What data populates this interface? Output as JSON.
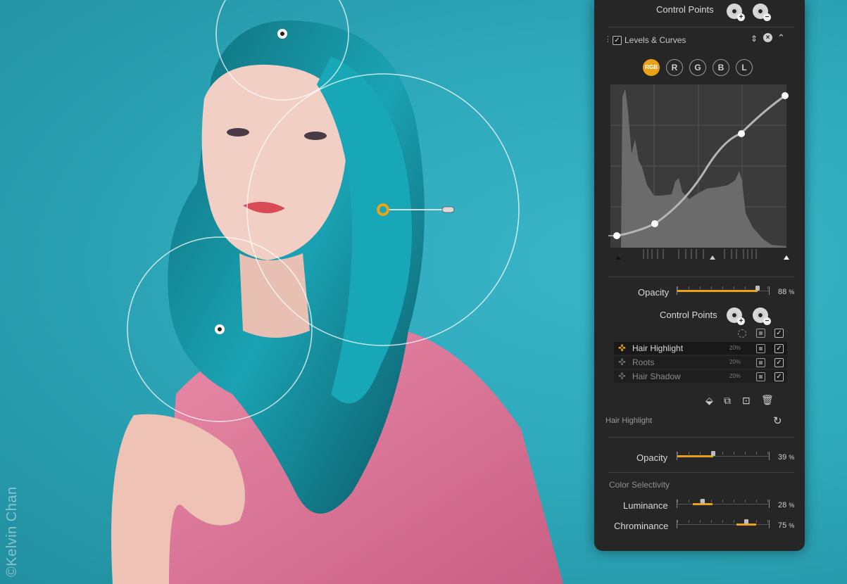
{
  "watermark": "©Kelvin Chan",
  "colors": {
    "accent": "#e8a21a",
    "panel": "#262626",
    "background": "#2aa8ba"
  },
  "panel": {
    "top_control_points_label": "Control Points",
    "filter": {
      "title": "Levels & Curves",
      "enabled": true
    },
    "channels": [
      "RGB",
      "R",
      "G",
      "B",
      "L"
    ],
    "active_channel": "RGB",
    "opacity": {
      "label": "Opacity",
      "value": "88",
      "unit": "%",
      "level": 0.88
    },
    "control_points_label": "Control Points",
    "control_points": [
      {
        "name": "Hair Highlight",
        "pct": "20%",
        "selected": true
      },
      {
        "name": "Roots",
        "pct": "20%",
        "selected": false
      },
      {
        "name": "Hair Shadow",
        "pct": "20%",
        "selected": false
      }
    ],
    "selected_point_label": "Hair Highlight",
    "point_opacity": {
      "label": "Opacity",
      "value": "39",
      "unit": "%",
      "level": 0.39
    },
    "color_selectivity_label": "Color Selectivity",
    "luminance": {
      "label": "Luminance",
      "value": "28",
      "unit": "%",
      "level": 0.28
    },
    "chrominance": {
      "label": "Chrominance",
      "value": "75",
      "unit": "%",
      "level": 0.75
    },
    "icons": [
      "add-point-icon",
      "remove-point-icon",
      "duplicate-icon",
      "mask-icon",
      "trash-icon",
      "reset-icon"
    ]
  }
}
